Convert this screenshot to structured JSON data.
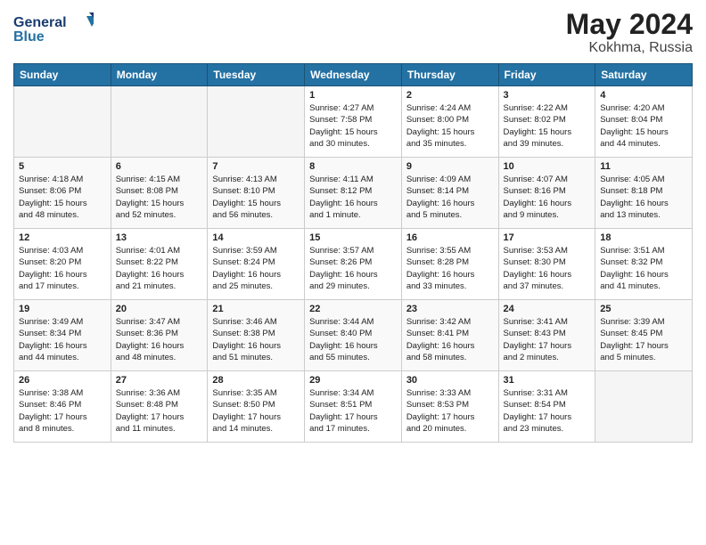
{
  "logo": {
    "text1": "General",
    "text2": "Blue"
  },
  "title": "May 2024",
  "location": "Kokhma, Russia",
  "days_header": [
    "Sunday",
    "Monday",
    "Tuesday",
    "Wednesday",
    "Thursday",
    "Friday",
    "Saturday"
  ],
  "weeks": [
    [
      {
        "num": "",
        "info": "",
        "empty": true
      },
      {
        "num": "",
        "info": "",
        "empty": true
      },
      {
        "num": "",
        "info": "",
        "empty": true
      },
      {
        "num": "1",
        "info": "Sunrise: 4:27 AM\nSunset: 7:58 PM\nDaylight: 15 hours\nand 30 minutes.",
        "empty": false
      },
      {
        "num": "2",
        "info": "Sunrise: 4:24 AM\nSunset: 8:00 PM\nDaylight: 15 hours\nand 35 minutes.",
        "empty": false
      },
      {
        "num": "3",
        "info": "Sunrise: 4:22 AM\nSunset: 8:02 PM\nDaylight: 15 hours\nand 39 minutes.",
        "empty": false
      },
      {
        "num": "4",
        "info": "Sunrise: 4:20 AM\nSunset: 8:04 PM\nDaylight: 15 hours\nand 44 minutes.",
        "empty": false
      }
    ],
    [
      {
        "num": "5",
        "info": "Sunrise: 4:18 AM\nSunset: 8:06 PM\nDaylight: 15 hours\nand 48 minutes.",
        "empty": false
      },
      {
        "num": "6",
        "info": "Sunrise: 4:15 AM\nSunset: 8:08 PM\nDaylight: 15 hours\nand 52 minutes.",
        "empty": false
      },
      {
        "num": "7",
        "info": "Sunrise: 4:13 AM\nSunset: 8:10 PM\nDaylight: 15 hours\nand 56 minutes.",
        "empty": false
      },
      {
        "num": "8",
        "info": "Sunrise: 4:11 AM\nSunset: 8:12 PM\nDaylight: 16 hours\nand 1 minute.",
        "empty": false
      },
      {
        "num": "9",
        "info": "Sunrise: 4:09 AM\nSunset: 8:14 PM\nDaylight: 16 hours\nand 5 minutes.",
        "empty": false
      },
      {
        "num": "10",
        "info": "Sunrise: 4:07 AM\nSunset: 8:16 PM\nDaylight: 16 hours\nand 9 minutes.",
        "empty": false
      },
      {
        "num": "11",
        "info": "Sunrise: 4:05 AM\nSunset: 8:18 PM\nDaylight: 16 hours\nand 13 minutes.",
        "empty": false
      }
    ],
    [
      {
        "num": "12",
        "info": "Sunrise: 4:03 AM\nSunset: 8:20 PM\nDaylight: 16 hours\nand 17 minutes.",
        "empty": false
      },
      {
        "num": "13",
        "info": "Sunrise: 4:01 AM\nSunset: 8:22 PM\nDaylight: 16 hours\nand 21 minutes.",
        "empty": false
      },
      {
        "num": "14",
        "info": "Sunrise: 3:59 AM\nSunset: 8:24 PM\nDaylight: 16 hours\nand 25 minutes.",
        "empty": false
      },
      {
        "num": "15",
        "info": "Sunrise: 3:57 AM\nSunset: 8:26 PM\nDaylight: 16 hours\nand 29 minutes.",
        "empty": false
      },
      {
        "num": "16",
        "info": "Sunrise: 3:55 AM\nSunset: 8:28 PM\nDaylight: 16 hours\nand 33 minutes.",
        "empty": false
      },
      {
        "num": "17",
        "info": "Sunrise: 3:53 AM\nSunset: 8:30 PM\nDaylight: 16 hours\nand 37 minutes.",
        "empty": false
      },
      {
        "num": "18",
        "info": "Sunrise: 3:51 AM\nSunset: 8:32 PM\nDaylight: 16 hours\nand 41 minutes.",
        "empty": false
      }
    ],
    [
      {
        "num": "19",
        "info": "Sunrise: 3:49 AM\nSunset: 8:34 PM\nDaylight: 16 hours\nand 44 minutes.",
        "empty": false
      },
      {
        "num": "20",
        "info": "Sunrise: 3:47 AM\nSunset: 8:36 PM\nDaylight: 16 hours\nand 48 minutes.",
        "empty": false
      },
      {
        "num": "21",
        "info": "Sunrise: 3:46 AM\nSunset: 8:38 PM\nDaylight: 16 hours\nand 51 minutes.",
        "empty": false
      },
      {
        "num": "22",
        "info": "Sunrise: 3:44 AM\nSunset: 8:40 PM\nDaylight: 16 hours\nand 55 minutes.",
        "empty": false
      },
      {
        "num": "23",
        "info": "Sunrise: 3:42 AM\nSunset: 8:41 PM\nDaylight: 16 hours\nand 58 minutes.",
        "empty": false
      },
      {
        "num": "24",
        "info": "Sunrise: 3:41 AM\nSunset: 8:43 PM\nDaylight: 17 hours\nand 2 minutes.",
        "empty": false
      },
      {
        "num": "25",
        "info": "Sunrise: 3:39 AM\nSunset: 8:45 PM\nDaylight: 17 hours\nand 5 minutes.",
        "empty": false
      }
    ],
    [
      {
        "num": "26",
        "info": "Sunrise: 3:38 AM\nSunset: 8:46 PM\nDaylight: 17 hours\nand 8 minutes.",
        "empty": false
      },
      {
        "num": "27",
        "info": "Sunrise: 3:36 AM\nSunset: 8:48 PM\nDaylight: 17 hours\nand 11 minutes.",
        "empty": false
      },
      {
        "num": "28",
        "info": "Sunrise: 3:35 AM\nSunset: 8:50 PM\nDaylight: 17 hours\nand 14 minutes.",
        "empty": false
      },
      {
        "num": "29",
        "info": "Sunrise: 3:34 AM\nSunset: 8:51 PM\nDaylight: 17 hours\nand 17 minutes.",
        "empty": false
      },
      {
        "num": "30",
        "info": "Sunrise: 3:33 AM\nSunset: 8:53 PM\nDaylight: 17 hours\nand 20 minutes.",
        "empty": false
      },
      {
        "num": "31",
        "info": "Sunrise: 3:31 AM\nSunset: 8:54 PM\nDaylight: 17 hours\nand 23 minutes.",
        "empty": false
      },
      {
        "num": "",
        "info": "",
        "empty": true
      }
    ]
  ]
}
